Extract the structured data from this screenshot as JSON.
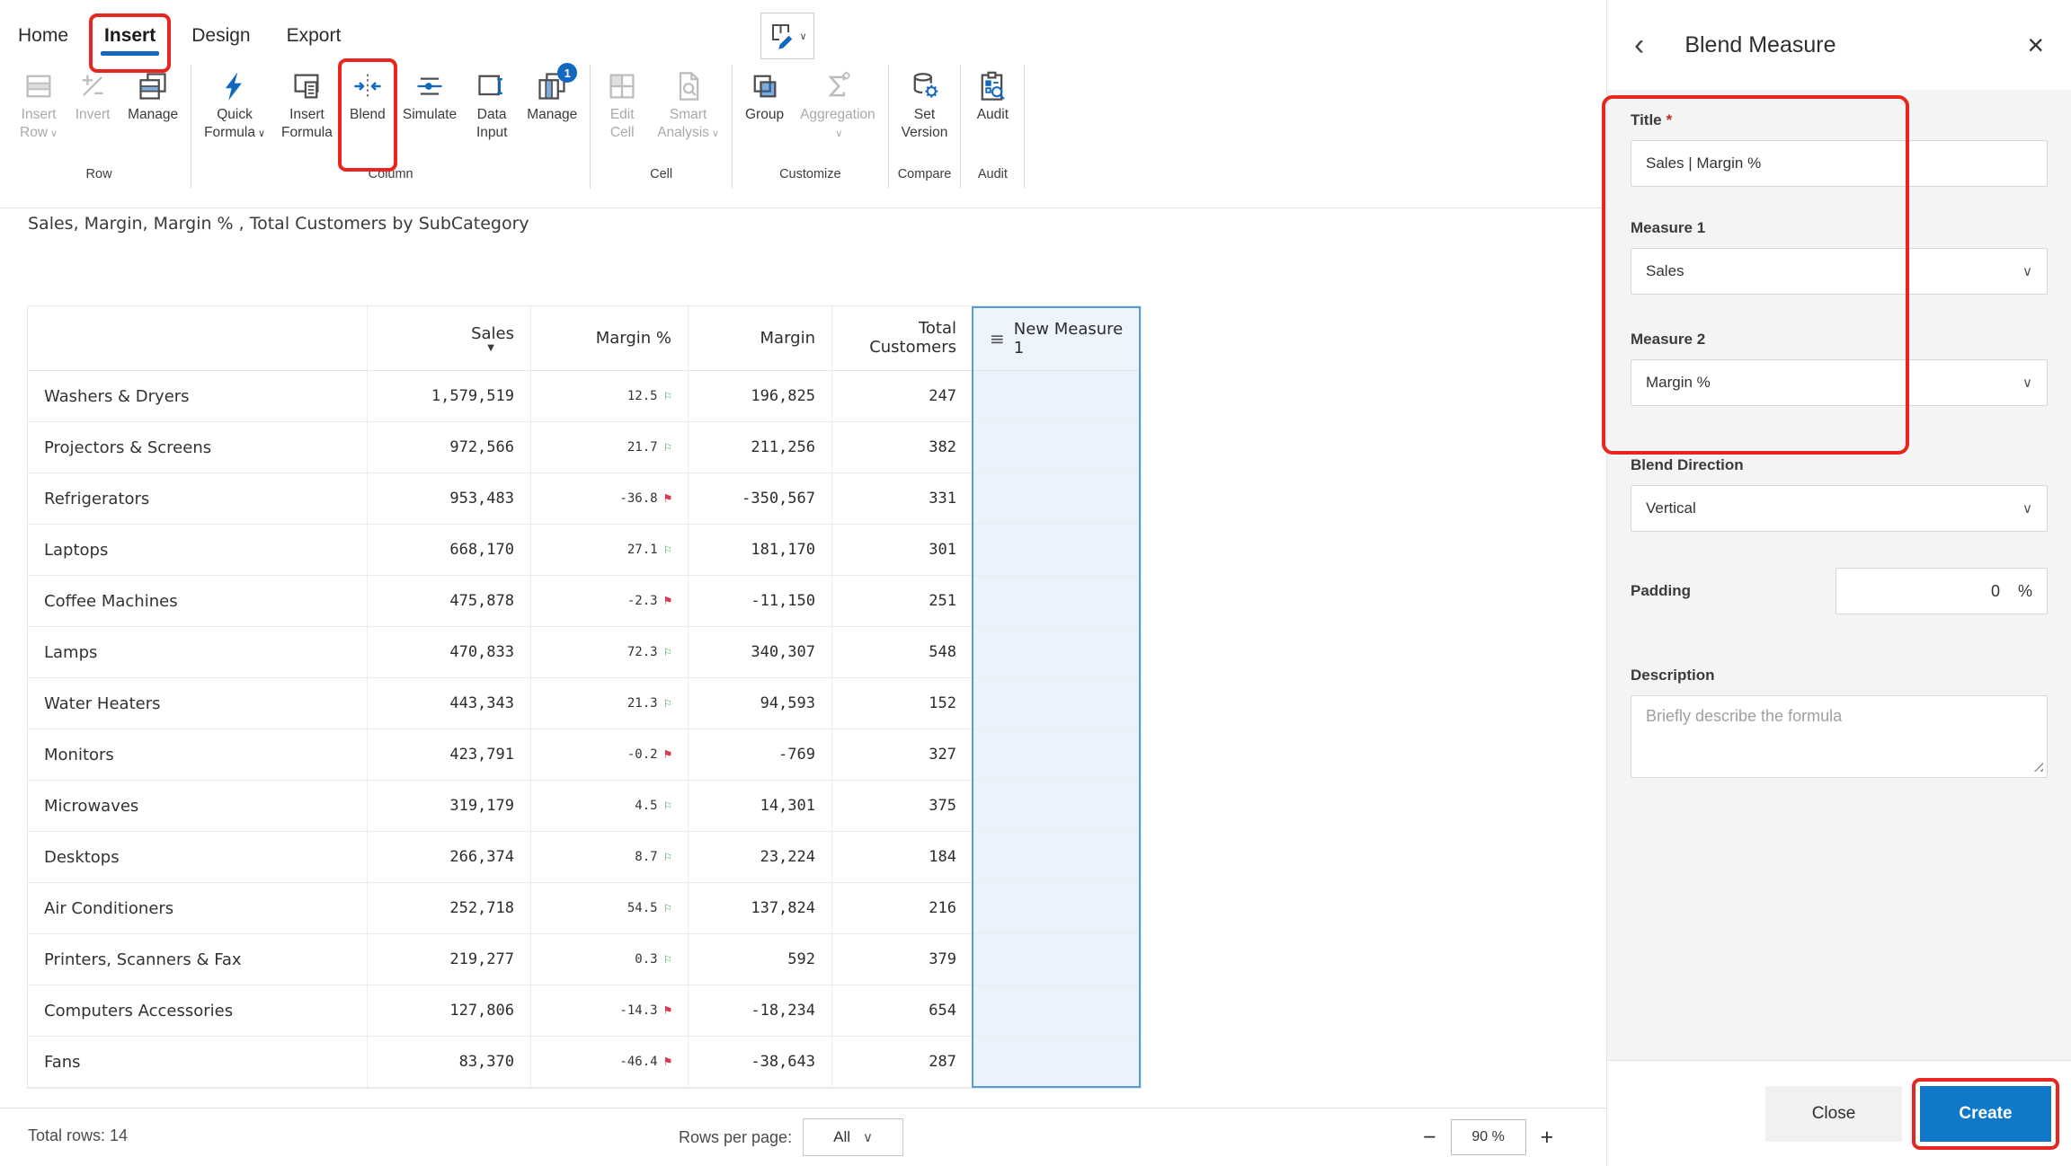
{
  "ribbon": {
    "tabs": [
      {
        "id": "home",
        "label": "Home"
      },
      {
        "id": "insert",
        "label": "Insert",
        "active": true,
        "annotated": true
      },
      {
        "id": "design",
        "label": "Design"
      },
      {
        "id": "export",
        "label": "Export"
      }
    ],
    "groups": [
      {
        "id": "row",
        "label": "Row",
        "buttons": [
          {
            "id": "insert-row",
            "lines": [
              "Insert",
              "Row"
            ],
            "dropdown": "inline",
            "disabled": true
          },
          {
            "id": "invert",
            "lines": [
              "Invert"
            ],
            "disabled": true
          },
          {
            "id": "manage-rows",
            "lines": [
              "Manage"
            ]
          }
        ]
      },
      {
        "id": "column",
        "label": "Column",
        "buttons": [
          {
            "id": "quick-formula",
            "lines": [
              "Quick",
              "Formula"
            ],
            "dropdown": "inline"
          },
          {
            "id": "insert-formula",
            "lines": [
              "Insert",
              "Formula"
            ]
          },
          {
            "id": "blend",
            "lines": [
              "Blend"
            ],
            "annotated": true
          },
          {
            "id": "simulate",
            "lines": [
              "Simulate"
            ]
          },
          {
            "id": "data-input",
            "lines": [
              "Data",
              "Input"
            ]
          },
          {
            "id": "manage-columns",
            "lines": [
              "Manage"
            ],
            "badge": "1"
          }
        ]
      },
      {
        "id": "cell",
        "label": "Cell",
        "buttons": [
          {
            "id": "edit-cell",
            "lines": [
              "Edit",
              "Cell"
            ],
            "disabled": true
          },
          {
            "id": "smart-analysis",
            "lines": [
              "Smart",
              "Analysis"
            ],
            "dropdown": "inline",
            "disabled": true
          }
        ]
      },
      {
        "id": "customize",
        "label": "Customize",
        "buttons": [
          {
            "id": "group",
            "lines": [
              "Group"
            ]
          },
          {
            "id": "aggregation",
            "lines": [
              "Aggregation"
            ],
            "dropdown": "below",
            "disabled": true
          }
        ]
      },
      {
        "id": "compare",
        "label": "Compare",
        "buttons": [
          {
            "id": "set-version",
            "lines": [
              "Set",
              "Version"
            ]
          }
        ]
      },
      {
        "id": "audit",
        "label": "Audit",
        "buttons": [
          {
            "id": "audit",
            "lines": [
              "Audit"
            ]
          }
        ]
      }
    ]
  },
  "table": {
    "title": "Sales, Margin, Margin % , Total Customers by SubCategory",
    "columns": {
      "c0": "",
      "c1": "Sales",
      "c2": "Margin %",
      "c3": "Margin",
      "c4": "Total Customers",
      "c5": "New Measure 1"
    },
    "sales_sort": "desc",
    "rows": [
      {
        "name": "Washers & Dryers",
        "sales": "1,579,519",
        "margin_pct": "12.5",
        "flag": "pos",
        "margin": "196,825",
        "customers": "247"
      },
      {
        "name": "Projectors & Screens",
        "sales": "972,566",
        "margin_pct": "21.7",
        "flag": "pos",
        "margin": "211,256",
        "customers": "382"
      },
      {
        "name": "Refrigerators",
        "sales": "953,483",
        "margin_pct": "-36.8",
        "flag": "neg",
        "margin": "-350,567",
        "customers": "331"
      },
      {
        "name": "Laptops",
        "sales": "668,170",
        "margin_pct": "27.1",
        "flag": "pos",
        "margin": "181,170",
        "customers": "301"
      },
      {
        "name": "Coffee Machines",
        "sales": "475,878",
        "margin_pct": "-2.3",
        "flag": "neg",
        "margin": "-11,150",
        "customers": "251"
      },
      {
        "name": "Lamps",
        "sales": "470,833",
        "margin_pct": "72.3",
        "flag": "pos",
        "margin": "340,307",
        "customers": "548"
      },
      {
        "name": "Water Heaters",
        "sales": "443,343",
        "margin_pct": "21.3",
        "flag": "pos",
        "margin": "94,593",
        "customers": "152"
      },
      {
        "name": "Monitors",
        "sales": "423,791",
        "margin_pct": "-0.2",
        "flag": "neg",
        "margin": "-769",
        "customers": "327"
      },
      {
        "name": "Microwaves",
        "sales": "319,179",
        "margin_pct": "4.5",
        "flag": "pos",
        "margin": "14,301",
        "customers": "375"
      },
      {
        "name": "Desktops",
        "sales": "266,374",
        "margin_pct": "8.7",
        "flag": "pos",
        "margin": "23,224",
        "customers": "184"
      },
      {
        "name": "Air Conditioners",
        "sales": "252,718",
        "margin_pct": "54.5",
        "flag": "pos",
        "margin": "137,824",
        "customers": "216"
      },
      {
        "name": "Printers, Scanners & Fax",
        "sales": "219,277",
        "margin_pct": "0.3",
        "flag": "pos",
        "margin": "592",
        "customers": "379"
      },
      {
        "name": "Computers Accessories",
        "sales": "127,806",
        "margin_pct": "-14.3",
        "flag": "neg",
        "margin": "-18,234",
        "customers": "654"
      },
      {
        "name": "Fans",
        "sales": "83,370",
        "margin_pct": "-46.4",
        "flag": "neg",
        "margin": "-38,643",
        "customers": "287"
      }
    ]
  },
  "status_bar": {
    "total_rows": "Total rows: 14",
    "rows_per_page_label": "Rows per page:",
    "rows_per_page_value": "All",
    "zoom_out": "−",
    "zoom_value": "90 %",
    "zoom_in": "+"
  },
  "panel": {
    "title": "Blend Measure",
    "required_mark": "*",
    "fields": {
      "title": {
        "label": "Title",
        "value": "Sales | Margin %"
      },
      "measure1": {
        "label": "Measure 1",
        "value": "Sales"
      },
      "measure2": {
        "label": "Measure 2",
        "value": "Margin %"
      },
      "blend_direction": {
        "label": "Blend Direction",
        "value": "Vertical"
      },
      "padding": {
        "label": "Padding",
        "value": "0",
        "unit": "%"
      },
      "description": {
        "label": "Description",
        "placeholder": "Briefly describe the formula"
      }
    },
    "footer": {
      "close": "Close",
      "create": "Create"
    }
  },
  "colors": {
    "accent": "#1267c1",
    "create_button": "#0f78c8",
    "annotation": "#e8261f",
    "flag_positive": "#3f9e52",
    "flag_negative": "#d93a4e",
    "highlight_column_bg": "#eaf2fb",
    "highlight_column_border": "#5b9bd5"
  }
}
